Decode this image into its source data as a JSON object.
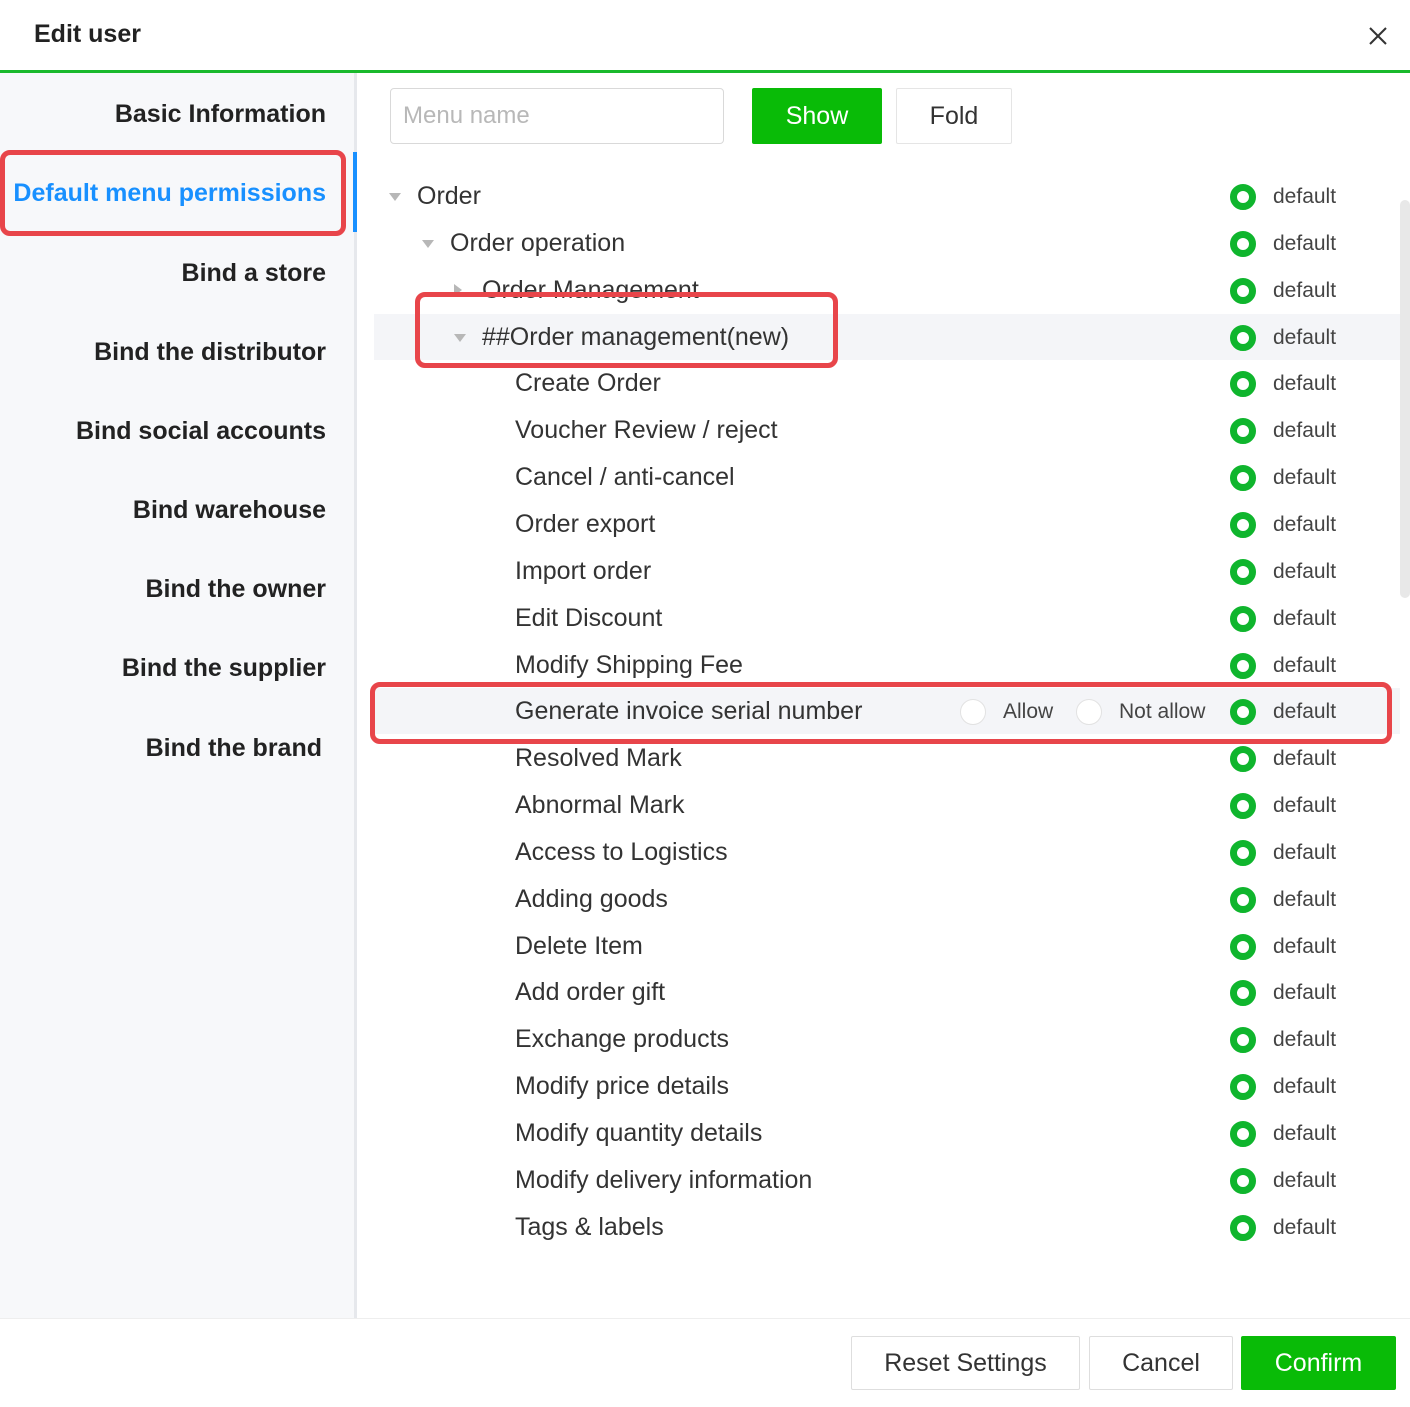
{
  "dialog": {
    "title": "Edit user"
  },
  "sidebar": {
    "items": [
      {
        "label": "Basic Information",
        "active": false
      },
      {
        "label": "Default menu permissions",
        "active": true
      },
      {
        "label": "Bind a store",
        "active": false
      },
      {
        "label": "Bind the distributor",
        "active": false
      },
      {
        "label": "Bind social accounts",
        "active": false
      },
      {
        "label": "Bind warehouse",
        "active": false
      },
      {
        "label": "Bind the owner",
        "active": false
      },
      {
        "label": "Bind the supplier",
        "active": false
      },
      {
        "label": "Bind the brand",
        "active": false
      }
    ]
  },
  "toolbar": {
    "search_placeholder": "Menu name",
    "search_value": "",
    "show_label": "Show",
    "fold_label": "Fold"
  },
  "tree": {
    "rows": [
      {
        "label": "Order",
        "state": "expanded",
        "selected": "default"
      },
      {
        "label": "Order operation",
        "state": "expanded",
        "selected": "default"
      },
      {
        "label": "Order Management",
        "state": "collapsed",
        "selected": "default"
      },
      {
        "label": "##Order management(new)",
        "state": "expanded",
        "selected": "default"
      },
      {
        "label": "Create Order",
        "state": "leaf",
        "selected": "default"
      },
      {
        "label": "Voucher Review / reject",
        "state": "leaf",
        "selected": "default"
      },
      {
        "label": "Cancel / anti-cancel",
        "state": "leaf",
        "selected": "default"
      },
      {
        "label": "Order export",
        "state": "leaf",
        "selected": "default"
      },
      {
        "label": "Import order",
        "state": "leaf",
        "selected": "default"
      },
      {
        "label": "Edit Discount",
        "state": "leaf",
        "selected": "default"
      },
      {
        "label": "Modify Shipping Fee",
        "state": "leaf",
        "selected": "default"
      },
      {
        "label": "Generate invoice serial number",
        "state": "leaf",
        "selected": "default",
        "show_options": true
      },
      {
        "label": "Resolved Mark",
        "state": "leaf",
        "selected": "default"
      },
      {
        "label": "Abnormal Mark",
        "state": "leaf",
        "selected": "default"
      },
      {
        "label": "Access to Logistics",
        "state": "leaf",
        "selected": "default"
      },
      {
        "label": "Adding goods",
        "state": "leaf",
        "selected": "default"
      },
      {
        "label": "Delete Item",
        "state": "leaf",
        "selected": "default"
      },
      {
        "label": "Add order gift",
        "state": "leaf",
        "selected": "default"
      },
      {
        "label": "Exchange products",
        "state": "leaf",
        "selected": "default"
      },
      {
        "label": "Modify price details",
        "state": "leaf",
        "selected": "default"
      },
      {
        "label": "Modify quantity details",
        "state": "leaf",
        "selected": "default"
      },
      {
        "label": "Modify delivery information",
        "state": "leaf",
        "selected": "default"
      },
      {
        "label": "Tags & labels",
        "state": "leaf",
        "selected": "default"
      }
    ],
    "option_labels": {
      "allow": "Allow",
      "not_allow": "Not allow",
      "default": "default"
    }
  },
  "footer": {
    "reset_label": "Reset Settings",
    "cancel_label": "Cancel",
    "confirm_label": "Confirm"
  },
  "colors": {
    "accent_green": "#09bb07",
    "active_blue": "#1890ff",
    "annotation_red": "#e8454a"
  },
  "icons": {
    "close": "close-icon",
    "expand": "caret-down-icon",
    "collapse": "caret-right-icon"
  }
}
